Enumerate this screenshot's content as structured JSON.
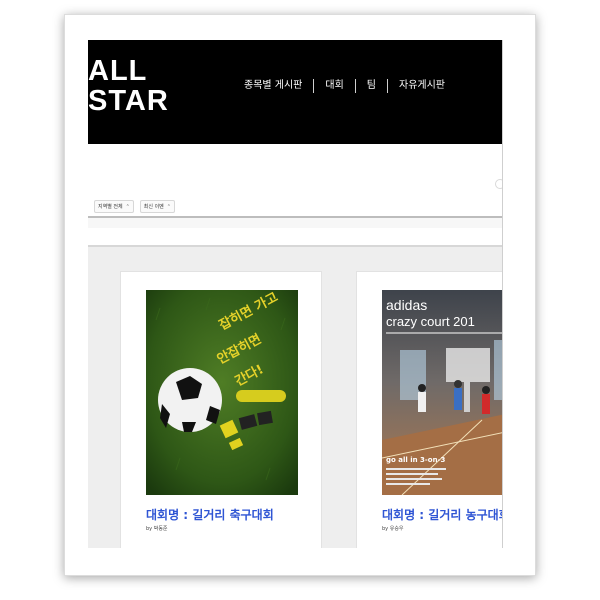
{
  "header": {
    "logo_line1": "ALL",
    "logo_line2": "STAR",
    "nav": [
      "종목별 게시판",
      "대회",
      "팀",
      "자유게시판"
    ]
  },
  "filters": [
    {
      "value": "지역별 전체"
    },
    {
      "value": "최신 이벤"
    }
  ],
  "cards": [
    {
      "title": "대회명 : 길거리 축구대회",
      "author": "by 박동준",
      "poster_texts": [
        "잡히면 가고",
        "안잡히면",
        "간다!"
      ]
    },
    {
      "title": "대회명 : 길거리 농구대회",
      "author": "by 유승우",
      "poster_texts": [
        "adidas",
        "crazy court 201",
        "go all in 3-on-3"
      ]
    }
  ],
  "colors": {
    "header_bg": "#000000",
    "title_blue": "#2f55d4",
    "content_bg": "#eeeeee"
  }
}
